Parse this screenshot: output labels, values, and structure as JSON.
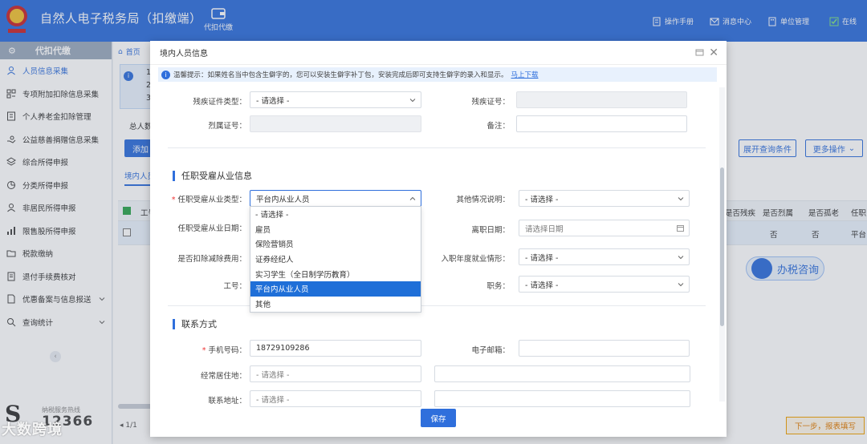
{
  "header": {
    "title": "自然人电子税务局（扣缴端）",
    "tab_label": "代扣代缴",
    "right_items": [
      "操作手册",
      "消息中心",
      "单位管理",
      "在线"
    ],
    "bg_color": "#2f6fdc"
  },
  "sidebar": {
    "head": "代扣代缴",
    "items": [
      {
        "label": "人员信息采集",
        "icon": "user-icon",
        "active": true
      },
      {
        "label": "专项附加扣除信息采集",
        "icon": "grid-icon"
      },
      {
        "label": "个人养老金扣除管理",
        "icon": "pension-icon"
      },
      {
        "label": "公益慈善捐赠信息采集",
        "icon": "donation-icon"
      },
      {
        "label": "综合所得申报",
        "icon": "layers-icon"
      },
      {
        "label": "分类所得申报",
        "icon": "pie-icon"
      },
      {
        "label": "非居民所得申报",
        "icon": "person-icon"
      },
      {
        "label": "限售股所得申报",
        "icon": "bar-icon"
      },
      {
        "label": "税款缴纳",
        "icon": "folder-icon"
      },
      {
        "label": "退付手续费核对",
        "icon": "doc-icon"
      },
      {
        "label": "优惠备案与信息报送",
        "icon": "file-icon"
      },
      {
        "label": "查询统计",
        "icon": "search-icon"
      }
    ],
    "hotline_label": "纳税服务热线",
    "hotline_number": "12366"
  },
  "background": {
    "breadcrumb_home": "首页",
    "tip_lines": [
      "1.",
      "2.",
      "3."
    ],
    "total_label": "总人数",
    "add_button": "添加",
    "tab_label": "境内人员",
    "expand_filter": "展开查询条件",
    "more_actions": "更多操作",
    "table_headers_left": [
      "工号"
    ],
    "table_headers_right": [
      "是否残疾",
      "是否烈属",
      "是否孤老",
      "任职"
    ],
    "row_values": [
      "否",
      "否",
      "平台"
    ],
    "consult_button": "办税咨询",
    "next_button": "下一步，报表填写",
    "pager": "1/1"
  },
  "modal": {
    "title": "境内人员信息",
    "tip_text": "温馨提示：如果姓名当中包含生僻字的，您可以安装生僻字补丁包，安装完成后即可支持生僻字的录入和显示。",
    "tip_link": "马上下载",
    "fields": {
      "disability_cert_type_label": "残疾证件类型：",
      "disability_cert_type_value": "- 请选择 -",
      "disability_cert_no_label": "残疾证号：",
      "martyr_cert_label": "烈属证号：",
      "remark_label": "备注：",
      "section_employment": "任职受雇从业信息",
      "employment_type_label": "任职受雇从业类型：",
      "employment_type_value": "平台内从业人员",
      "other_desc_label": "其他情况说明：",
      "other_desc_value": "- 请选择 -",
      "employment_date_label": "任职受雇从业日期：",
      "leave_date_label": "离职日期：",
      "leave_date_placeholder": "请选择日期",
      "deduct_fee_label": "是否扣除减除费用：",
      "first_year_label": "入职年度就业情形：",
      "first_year_value": "- 请选择 -",
      "job_no_label": "工号：",
      "position_label": "职务：",
      "position_value": "- 请选择 -",
      "section_contact": "联系方式",
      "phone_label": "手机号码：",
      "phone_value": "18729109286",
      "email_label": "电子邮箱：",
      "residence_label": "经常居住地：",
      "residence_value": "- 请选择 -",
      "address_label": "联系地址：",
      "address_value": "- 请选择 -"
    },
    "dropdown_options": [
      "- 请选择 -",
      "雇员",
      "保险营销员",
      "证券经纪人",
      "实习学生（全日制学历教育）",
      "平台内从业人员",
      "其他"
    ],
    "dropdown_selected_index": 5,
    "save_button": "保存"
  },
  "watermark": "大数跨境"
}
